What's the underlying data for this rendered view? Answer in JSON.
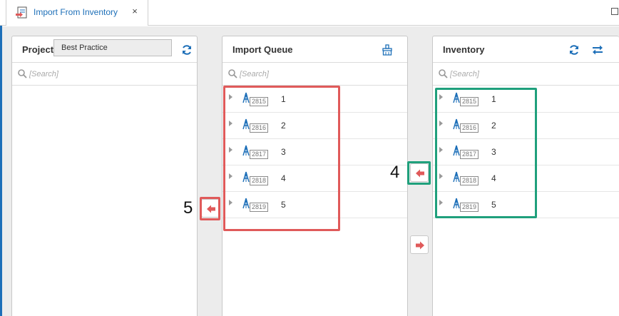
{
  "tab": {
    "title": "Import From Inventory",
    "close_glyph": "×",
    "icon": "import-document-icon"
  },
  "panels": {
    "project": {
      "title": "Project",
      "dropdown_value": "Best Practice",
      "search_placeholder": "[Search]",
      "items": []
    },
    "queue": {
      "title": "Import Queue",
      "search_placeholder": "[Search]",
      "items": [
        {
          "tag": "2815",
          "label": "1"
        },
        {
          "tag": "2816",
          "label": "2"
        },
        {
          "tag": "2817",
          "label": "3"
        },
        {
          "tag": "2818",
          "label": "4"
        },
        {
          "tag": "2819",
          "label": "5"
        }
      ]
    },
    "inventory": {
      "title": "Inventory",
      "search_placeholder": "[Search]",
      "items": [
        {
          "tag": "2815",
          "label": "1"
        },
        {
          "tag": "2816",
          "label": "2"
        },
        {
          "tag": "2817",
          "label": "3"
        },
        {
          "tag": "2818",
          "label": "4"
        },
        {
          "tag": "2819",
          "label": "5"
        }
      ]
    }
  },
  "annotations": {
    "step4": "4",
    "step5": "5"
  },
  "colors": {
    "accent": "#1d6fb8",
    "arrow": "#e05a5a",
    "highlight_red": "#e05a5a",
    "highlight_green": "#1fa07c"
  }
}
